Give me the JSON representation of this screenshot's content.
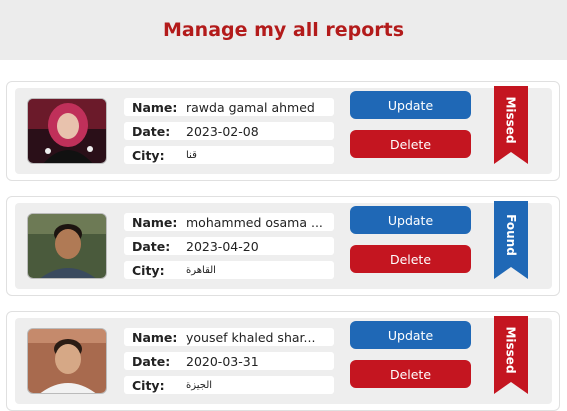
{
  "page": {
    "title": "Manage my all reports"
  },
  "labels": {
    "name": "Name:",
    "date": "Date:",
    "city": "City:"
  },
  "colors": {
    "missed": "#c41520",
    "found": "#1f68b6",
    "title": "#b31b1b"
  },
  "reports": [
    {
      "name": "rawda gamal ahmed",
      "date": "2023-02-08",
      "city": "قنا",
      "status": "Missed",
      "update_label": "Update",
      "delete_label": "Delete"
    },
    {
      "name": "mohammed osama ...",
      "date": "2023-04-20",
      "city": "القاهرة",
      "status": "Found",
      "update_label": "Update",
      "delete_label": "Delete"
    },
    {
      "name": "yousef khaled shar...",
      "date": "2020-03-31",
      "city": "الجيزة",
      "status": "Missed",
      "update_label": "Update",
      "delete_label": "Delete"
    }
  ]
}
